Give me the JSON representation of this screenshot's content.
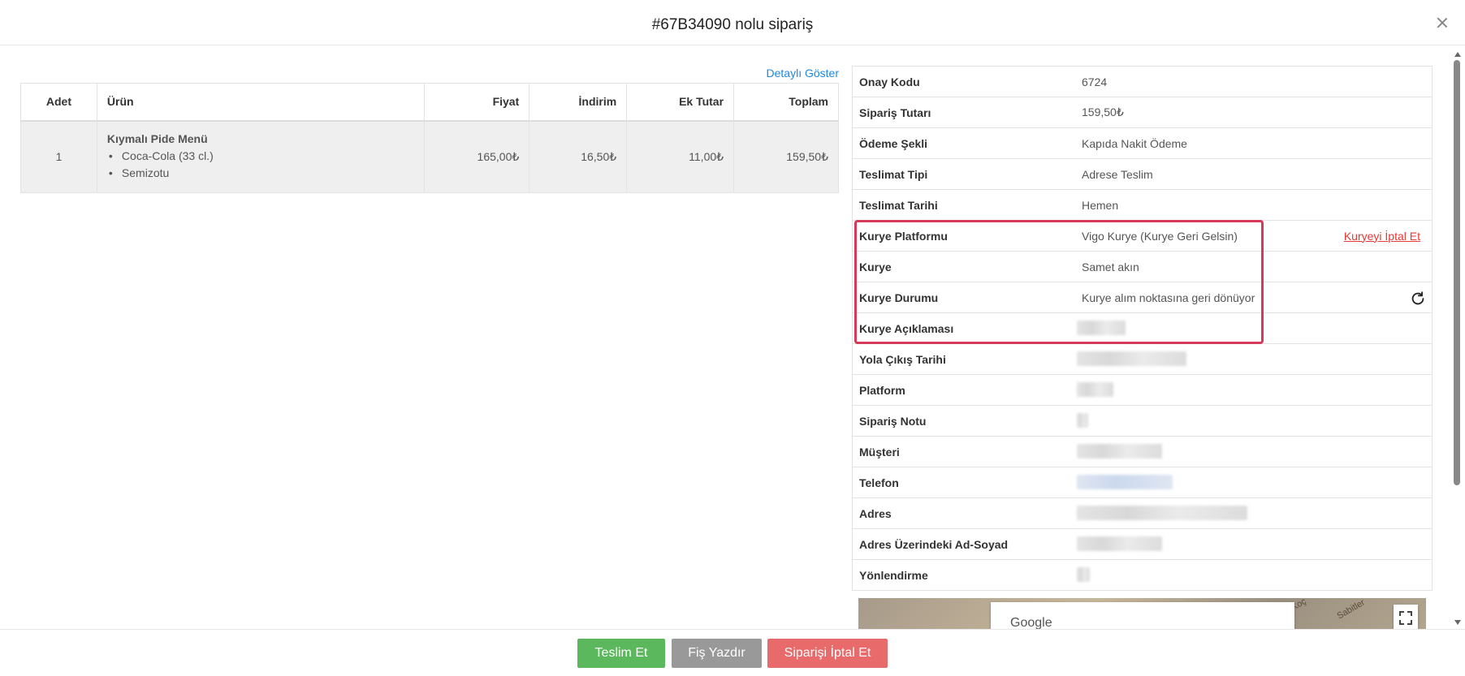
{
  "header": {
    "title": "#67B34090 nolu sipariş"
  },
  "detail_link": "Detaylı Göster",
  "items_table": {
    "columns": [
      "Adet",
      "Ürün",
      "Fiyat",
      "İndirim",
      "Ek Tutar",
      "Toplam"
    ],
    "rows": [
      {
        "adet": "1",
        "urun": "Kıymalı Pide Menü",
        "options": [
          "Coca-Cola (33 cl.)",
          "Semizotu"
        ],
        "fiyat": "165,00₺",
        "indirim": "16,50₺",
        "ek_tutar": "11,00₺",
        "toplam": "159,50₺"
      }
    ]
  },
  "info": {
    "onay_kodu": {
      "label": "Onay Kodu",
      "value": "6724"
    },
    "siparis_tutari": {
      "label": "Sipariş Tutarı",
      "value": "159,50₺"
    },
    "odeme_sekli": {
      "label": "Ödeme Şekli",
      "value": "Kapıda Nakit Ödeme"
    },
    "teslimat_tipi": {
      "label": "Teslimat Tipi",
      "value": "Adrese Teslim"
    },
    "teslimat_tarihi": {
      "label": "Teslimat Tarihi",
      "value": "Hemen"
    },
    "kurye_platformu": {
      "label": "Kurye Platformu",
      "value": "Vigo Kurye (Kurye Geri Gelsin)",
      "action": "Kuryeyi İptal Et"
    },
    "kurye": {
      "label": "Kurye",
      "value": "Samet akın"
    },
    "kurye_durumu": {
      "label": "Kurye Durumu",
      "value": "Kurye alım noktasına geri dönüyor"
    },
    "kurye_aciklamasi": {
      "label": "Kurye Açıklaması"
    },
    "yola_cikis_tarihi": {
      "label": "Yola Çıkış Tarihi"
    },
    "platform": {
      "label": "Platform"
    },
    "siparis_notu": {
      "label": "Sipariş Notu"
    },
    "musteri": {
      "label": "Müşteri"
    },
    "telefon": {
      "label": "Telefon"
    },
    "adres": {
      "label": "Adres"
    },
    "adres_ad_soyad": {
      "label": "Adres Üzerindeki Ad-Soyad"
    },
    "yonlendirme": {
      "label": "Yönlendirme"
    }
  },
  "map": {
    "brand": "Google",
    "street_1": "Koç",
    "street_2": "Sabitler"
  },
  "footer": {
    "deliver_label": "Teslim Et",
    "print_label": "Fiş Yazdır",
    "cancel_label": "Siparişi İptal Et"
  },
  "colors": {
    "highlight": "#d63a5a",
    "link": "#1e88e5",
    "danger_link": "#e53935",
    "deliver_button": "#5cb85c",
    "print_button": "#999999",
    "cancel_button": "#e86a6a"
  }
}
